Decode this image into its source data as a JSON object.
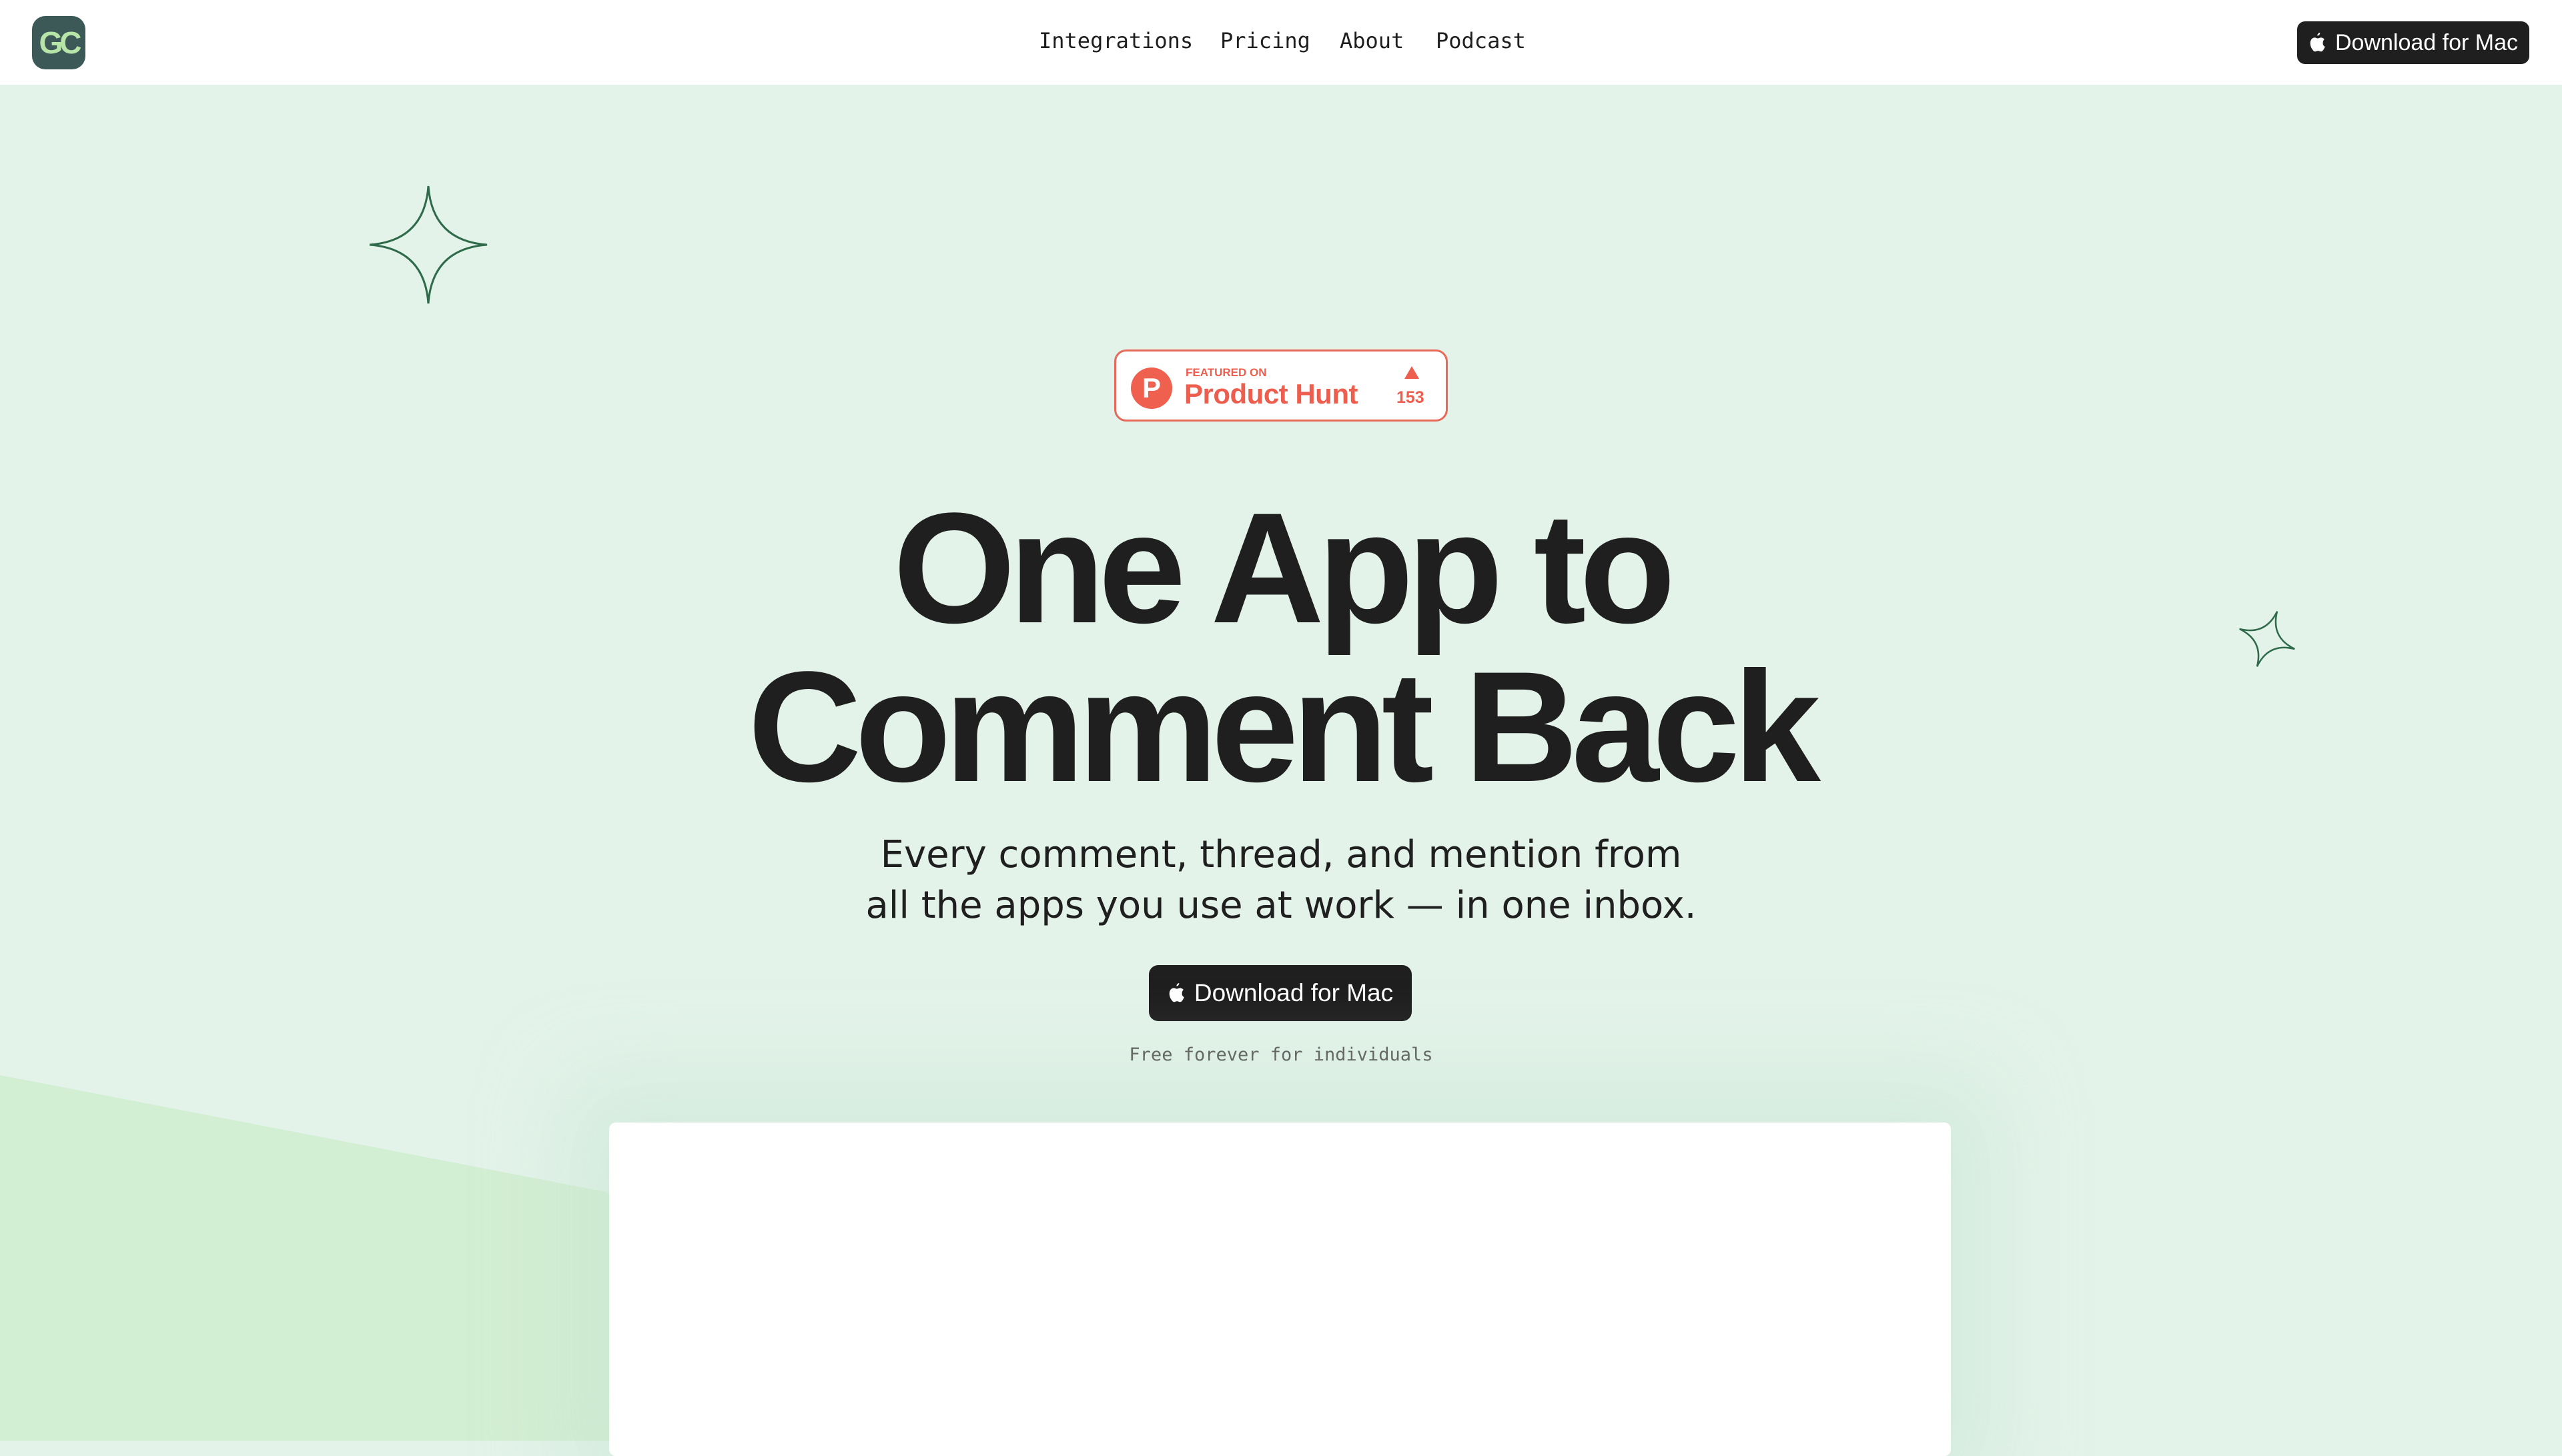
{
  "header": {
    "logo_text": "GC",
    "nav": [
      {
        "label": "Integrations"
      },
      {
        "label": "Pricing"
      },
      {
        "label": "About"
      },
      {
        "label": "Podcast"
      }
    ],
    "download_label": "Download for Mac"
  },
  "badge": {
    "featured_on": "FEATURED ON",
    "name": "Product Hunt",
    "upvotes": "153",
    "color": "#ee5e4e"
  },
  "hero": {
    "title_line1": "One App to",
    "title_line2": "Comment Back",
    "subtitle_line1": "Every comment, thread, and mention from",
    "subtitle_line2": "all the apps you use at work — in one inbox.",
    "cta_label": "Download for Mac",
    "note": "Free forever for individuals"
  },
  "colors": {
    "background": "#e3f3ea",
    "accent_green": "#d2eed3",
    "button": "#1f1f1f"
  }
}
